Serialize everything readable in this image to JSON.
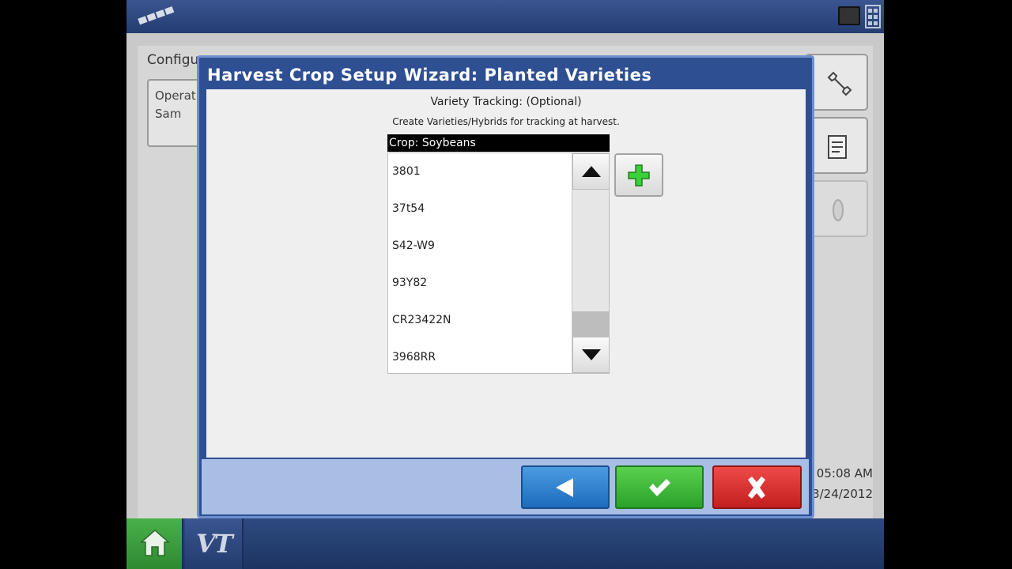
{
  "background": {
    "config_label": "Configu",
    "operator_label": "Operat",
    "operator_value": "Sam",
    "time": "05:08 AM",
    "date": "3/24/2012"
  },
  "dialog": {
    "title": "Harvest Crop Setup Wizard:  Planted Varieties",
    "heading": "Variety Tracking: (Optional)",
    "subheading": "Create Varieties/Hybrids for tracking at harvest.",
    "list_header": "Crop: Soybeans",
    "varieties": [
      "3801",
      "37t54",
      "S42-W9",
      "93Y82",
      "CR23422N",
      "3968RR"
    ]
  },
  "bottom_bar": {
    "vt_label": "VT"
  },
  "colors": {
    "dialog_title_bg": "#2f4f93",
    "back_button": "#2a7fd0",
    "ok_button": "#3cb83a",
    "cancel_button": "#d83232",
    "home_button": "#3f9e40"
  },
  "icons": {
    "gps": "gps-satellite-icon",
    "monitor": "monitor-icon",
    "layout": "layout-icon",
    "wrench": "wrench-icon",
    "report": "report-icon",
    "seed": "seed-icon",
    "add": "plus-icon",
    "scroll_up": "arrow-up-icon",
    "scroll_down": "arrow-down-icon",
    "back": "back-arrow-icon",
    "ok": "checkmark-icon",
    "cancel": "close-icon",
    "home": "home-icon"
  }
}
